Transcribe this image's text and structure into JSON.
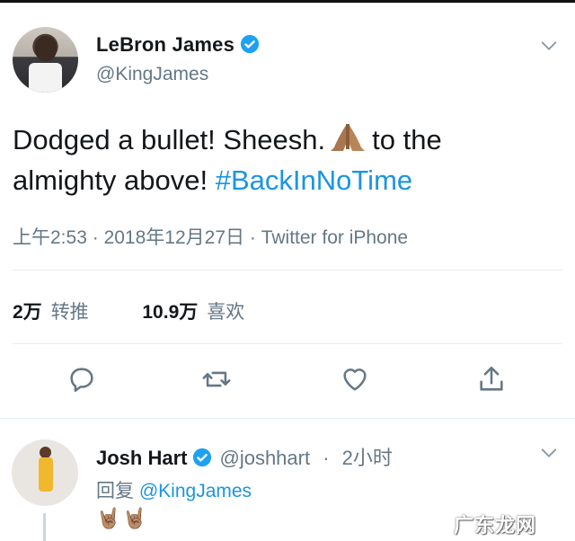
{
  "tweet": {
    "author_name": "LeBron James",
    "author_handle": "@KingJames",
    "text_part1": "Dodged a bullet! Sheesh.",
    "text_part2": "to the almighty above!",
    "hashtag": "#BackInNoTime",
    "time": "上午2:53",
    "date": "2018年12月27日",
    "source": "Twitter for iPhone",
    "meta_sep": "·",
    "retweets_count": "2万",
    "retweets_label": "转推",
    "likes_count": "10.9万",
    "likes_label": "喜欢"
  },
  "reply": {
    "author_name": "Josh Hart",
    "author_handle": "@joshhart",
    "time": "2小时",
    "sep": "·",
    "reply_prefix": "回复",
    "reply_to": "@KingJames",
    "text": "🤘🏽🤘🏽"
  },
  "watermark": "广东龙网",
  "icons": {
    "verified": "verified-badge-icon",
    "chevron": "chevron-down-icon",
    "reply": "reply-icon",
    "retweet": "retweet-icon",
    "like": "heart-icon",
    "share": "share-icon",
    "emoji": "folded-hands-emoji"
  },
  "colors": {
    "accent": "#1b95e0",
    "muted": "#657786",
    "verified": "#1da1f2"
  }
}
